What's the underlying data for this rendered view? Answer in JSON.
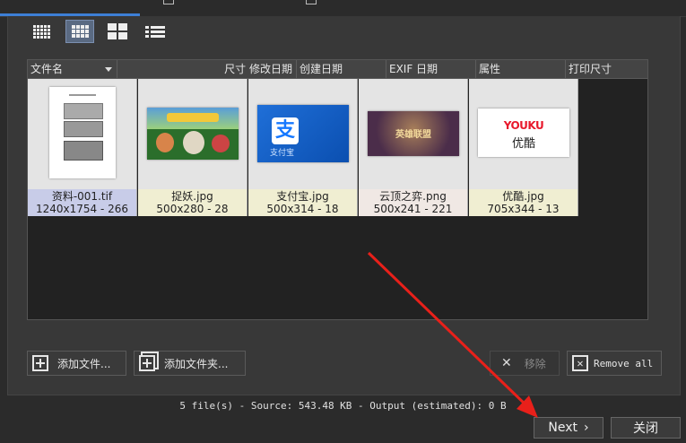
{
  "colors": {
    "accent": "#3d7fd6",
    "arrow": "#e8201a",
    "tile_selected_caption": "#c8cce8",
    "tile_caption": "#f0eed2"
  },
  "view_buttons": [
    {
      "icon": "small-grid-icon",
      "active": false
    },
    {
      "icon": "medium-grid-icon",
      "active": true
    },
    {
      "icon": "large-grid-icon",
      "active": false
    },
    {
      "icon": "list-view-icon",
      "active": false
    }
  ],
  "columns": {
    "filename": "文件名",
    "size_modified": "尺寸 修改日期",
    "created": "创建日期",
    "exif": "EXIF 日期",
    "attributes": "属性",
    "print_size": "打印尺寸"
  },
  "files": [
    {
      "name": "资料-001.tif",
      "info": "1240x1754 - 266"
    },
    {
      "name": "捉妖.jpg",
      "info": "500x280 - 28"
    },
    {
      "name": "支付宝.jpg",
      "info": "500x314 - 18"
    },
    {
      "name": "云顶之弈.png",
      "info": "500x241 - 221"
    },
    {
      "name": "优酷.jpg",
      "info": "705x344 - 13"
    }
  ],
  "thumb_text": {
    "alipay": "支付宝",
    "yunding": "英雄联盟",
    "youku_brand": "YOUKU",
    "youku_cn": "优酷"
  },
  "buttons": {
    "add_files": "添加文件...",
    "add_folder": "添加文件夹...",
    "remove": "移除",
    "remove_all": "Remove all"
  },
  "status": "5 file(s) - Source: 543.48 KB - Output (estimated): 0 B",
  "footer": {
    "next": "Next",
    "close": "关闭"
  }
}
